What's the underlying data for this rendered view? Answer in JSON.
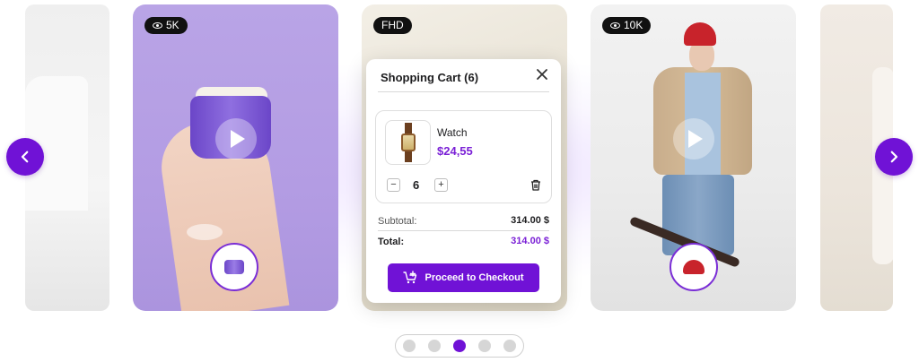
{
  "cards": {
    "cosmetic": {
      "badge": "5K"
    },
    "fhd": {
      "badge": "FHD"
    },
    "fashion": {
      "badge": "10K"
    }
  },
  "cart": {
    "title": "Shopping Cart (6)",
    "item": {
      "name": "Watch",
      "price": "$24,55",
      "quantity": "6"
    },
    "qty_minus": "−",
    "qty_plus": "+",
    "subtotal_label": "Subtotal:",
    "subtotal_value": "314.00 $",
    "total_label": "Total:",
    "total_value": "314.00 $",
    "checkout_label": "Proceed to Checkout"
  },
  "pagination": {
    "count": 5,
    "active_index": 2
  },
  "icons": {
    "arrow_left": "chevron-left-icon",
    "arrow_right": "chevron-right-icon",
    "close": "close-icon",
    "trash": "trash-icon",
    "cart": "cart-add-icon",
    "eye": "eye-icon",
    "play": "play-icon"
  },
  "colors": {
    "accent": "#7012d6",
    "price": "#7a1fd6",
    "badge_bg": "#111111"
  }
}
